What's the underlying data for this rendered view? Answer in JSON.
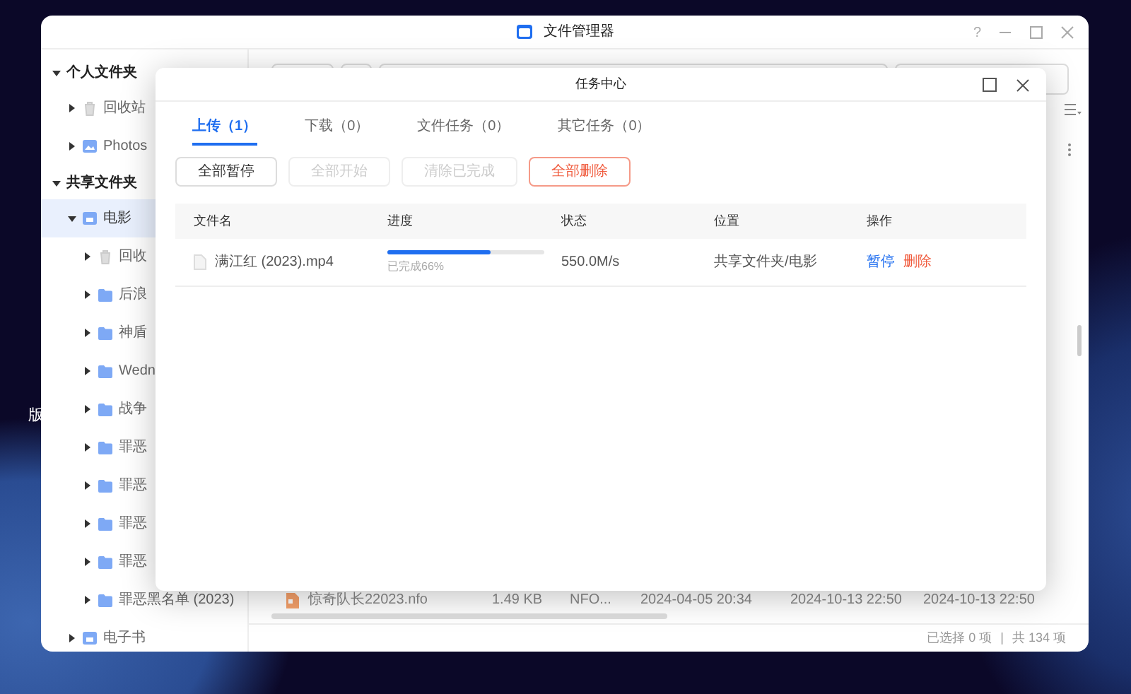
{
  "desktop": {
    "icon_label": "版"
  },
  "window": {
    "title": "文件管理器",
    "help": "?"
  },
  "sidebar": {
    "items": [
      {
        "label": "个人文件夹",
        "kind": "section",
        "expanded": true,
        "selected": false,
        "children": [
          {
            "label": "回收站",
            "kind": "trash",
            "expanded": false,
            "selected": false
          },
          {
            "label": "Photos",
            "kind": "photos",
            "expanded": false,
            "selected": false
          }
        ]
      },
      {
        "label": "共享文件夹",
        "kind": "section",
        "expanded": true,
        "selected": false,
        "children": [
          {
            "label": "电影",
            "kind": "shared",
            "expanded": true,
            "selected": true,
            "children": [
              {
                "label": "回收",
                "kind": "trash",
                "expanded": false,
                "selected": false
              },
              {
                "label": "后浪",
                "kind": "folder",
                "expanded": false,
                "selected": false
              },
              {
                "label": "神盾",
                "kind": "folder",
                "expanded": false,
                "selected": false
              },
              {
                "label": "Wedn",
                "kind": "folder",
                "expanded": false,
                "selected": false
              },
              {
                "label": "战争",
                "kind": "folder",
                "expanded": false,
                "selected": false
              },
              {
                "label": "罪恶",
                "kind": "folder",
                "expanded": false,
                "selected": false
              },
              {
                "label": "罪恶",
                "kind": "folder",
                "expanded": false,
                "selected": false
              },
              {
                "label": "罪恶",
                "kind": "folder",
                "expanded": false,
                "selected": false
              },
              {
                "label": "罪恶",
                "kind": "folder",
                "expanded": false,
                "selected": false
              },
              {
                "label": "罪恶黑名单 (2023)",
                "kind": "folder",
                "expanded": false,
                "selected": false
              }
            ]
          },
          {
            "label": "电子书",
            "kind": "shared",
            "expanded": false,
            "selected": false
          }
        ]
      }
    ]
  },
  "file_row": {
    "name": "惊奇队长22023.nfo",
    "size": "1.49 KB",
    "type": "NFO...",
    "date_1": "2024-04-05 20:34",
    "date_2": "2024-10-13 22:50",
    "date_3": "2024-10-13 22:50"
  },
  "status_bar": {
    "selected": "已选择 0 项",
    "separator": "|",
    "total": "共 134 项"
  },
  "task_dialog": {
    "title": "任务中心",
    "tabs": [
      {
        "label": "上传（1）",
        "selected": true
      },
      {
        "label": "下载（0）",
        "selected": false
      },
      {
        "label": "文件任务（0）",
        "selected": false
      },
      {
        "label": "其它任务（0）",
        "selected": false
      }
    ],
    "buttons": [
      {
        "label": "全部暂停",
        "kind": "default",
        "disabled": false
      },
      {
        "label": "全部开始",
        "kind": "default",
        "disabled": true
      },
      {
        "label": "清除已完成",
        "kind": "default",
        "disabled": true
      },
      {
        "label": "全部删除",
        "kind": "danger",
        "disabled": false
      }
    ],
    "table": {
      "columns": [
        "文件名",
        "进度",
        "状态",
        "位置",
        "操作"
      ],
      "rows": [
        {
          "name": "满江红 (2023).mp4",
          "level": 0.66,
          "progress_text": "已完成66%",
          "status": "550.0M/s",
          "location": "共享文件夹/电影",
          "actions": [
            {
              "label": "暂停",
              "kind": "primary"
            },
            {
              "label": "删除",
              "kind": "danger"
            }
          ]
        }
      ]
    }
  }
}
